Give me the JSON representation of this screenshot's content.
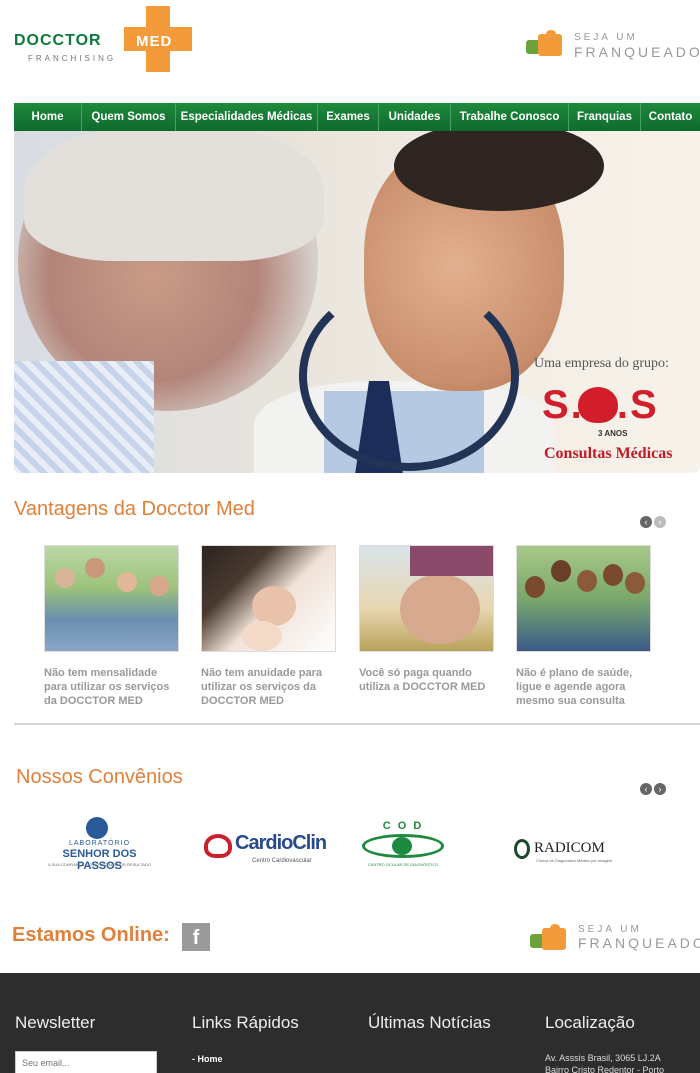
{
  "header": {
    "logo": {
      "name_part1": "DOCCTOR",
      "name_part2": "MED",
      "subtitle": "FRANCHISING"
    },
    "franchise": {
      "line1": "SEJA UM",
      "line2": "FRANQUEADO"
    }
  },
  "nav": {
    "items": [
      {
        "label": "Home"
      },
      {
        "label": "Quem Somos"
      },
      {
        "label": "Especialidades Médicas"
      },
      {
        "label": "Exames"
      },
      {
        "label": "Unidades"
      },
      {
        "label": "Trabalhe Conosco"
      },
      {
        "label": "Franquias"
      },
      {
        "label": "Contato"
      }
    ]
  },
  "hero": {
    "group_text": "Uma empresa do grupo:",
    "sos_text": "S.O.S",
    "sos_badge": "3 ANOS",
    "sos_sub": "Consultas Médicas"
  },
  "vantagens": {
    "title": "Vantagens da Docctor Med",
    "items": [
      {
        "caption": "Não tem mensalidade para utilizar os serviços da DOCCTOR MED"
      },
      {
        "caption": "Não tem anuidade para utilizar os serviços da DOCCTOR MED"
      },
      {
        "caption": "Você só paga quando utiliza a DOCCTOR MED"
      },
      {
        "caption": "Não é plano de saúde, ligue e agende agora mesmo sua consulta"
      }
    ]
  },
  "convenios": {
    "title": "Nossos Convênios",
    "partners": [
      {
        "top": "LABORATÓRIO",
        "name": "SENHOR DOS PASSOS",
        "tagline": "A SUA CONFIANÇA E O NOSSO MELHOR RESULTADO"
      },
      {
        "name": "CardioClin",
        "tagline": "Centro Cardiovascular"
      },
      {
        "name": "C O D",
        "tagline": "CENTRO OCULAR DE DIAGNÓSTICO"
      },
      {
        "name": "RADICOM",
        "tagline": "Clínica de Diagnóstico Médico por Imagem"
      }
    ]
  },
  "online": {
    "title": "Estamos Online:",
    "fb_icon": "f"
  },
  "footer": {
    "newsletter_title": "Newsletter",
    "newsletter_placeholder": "Seu email...",
    "links_title": "Links Rápidos",
    "links": [
      "- Home"
    ],
    "news_title": "Últimas Notícias",
    "location_title": "Localização",
    "address_line1": "Av. Asssis Brasil, 3065 LJ.2A",
    "address_line2": "Bairro Cristo Redentor - Porto"
  },
  "colors": {
    "accent_orange": "#e0803a",
    "nav_green": "#0e6a2c",
    "footer_bg": "#2d2d2d"
  }
}
